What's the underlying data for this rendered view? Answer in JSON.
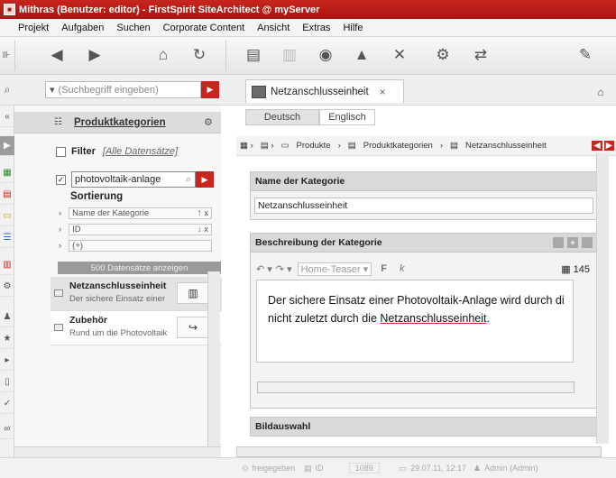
{
  "window": {
    "title": "Mithras (Benutzer: editor) - FirstSpirit SiteArchitect @ myServer"
  },
  "menu": [
    "Projekt",
    "Aufgaben",
    "Suchen",
    "Corporate Content",
    "Ansicht",
    "Extras",
    "Hilfe"
  ],
  "search": {
    "placeholder": "(Suchbegriff eingeben)",
    "dropdown_glyph": "▾"
  },
  "editor_tab": {
    "label": "Netzanschlusseinheit",
    "close_glyph": "×"
  },
  "left_panel": {
    "title": "Produktkategorien",
    "filter_label": "Filter",
    "filter_link": "[Alle Datensätze]",
    "filter_value": "photovoltaik-anlage",
    "sort_title": "Sortierung",
    "sort_rows": [
      {
        "label": "Name der Kategorie",
        "dir": "↑ x"
      },
      {
        "label": "ID",
        "dir": "↓ x"
      },
      {
        "label": "(+)",
        "dir": ""
      }
    ],
    "show_records": "500 Datensätze anzeigen",
    "results": [
      {
        "title": "Netzanschlusseinheit",
        "subtitle": "Der sichere Einsatz einer"
      },
      {
        "title": "Zubehör",
        "subtitle": "Rund um die Photovoltaik"
      }
    ]
  },
  "content": {
    "languages": [
      "Deutsch",
      "Englisch"
    ],
    "breadcrumb": [
      "Produkte",
      "Produktkategorien",
      "Netzanschlusseinheit"
    ],
    "name_section": {
      "label": "Name der Kategorie",
      "value": "Netzanschlusseinheit"
    },
    "desc_section": {
      "label": "Beschreibung der Kategorie",
      "style_placeholder": "Home-Teaser",
      "bold": "F",
      "italic": "k",
      "count": "145",
      "text_line1": "Der sichere Einsatz einer Photovoltaik-Anlage wird durch di",
      "text_line2_prefix": "nicht zuletzt durch die ",
      "text_line2_link": "Netzanschlusseinheit",
      "text_line2_suffix": "."
    },
    "image_section": {
      "label": "Bildauswahl"
    }
  },
  "status": {
    "released": "freigegeben",
    "id_label": "ID",
    "id_value": "1089",
    "date": "29.07.11, 12:17",
    "user": "Admin (Admin)"
  },
  "colors": {
    "brand": "#c8251f",
    "header_bg": "#d9d9d9",
    "panel_bg": "#f3f3f3"
  }
}
